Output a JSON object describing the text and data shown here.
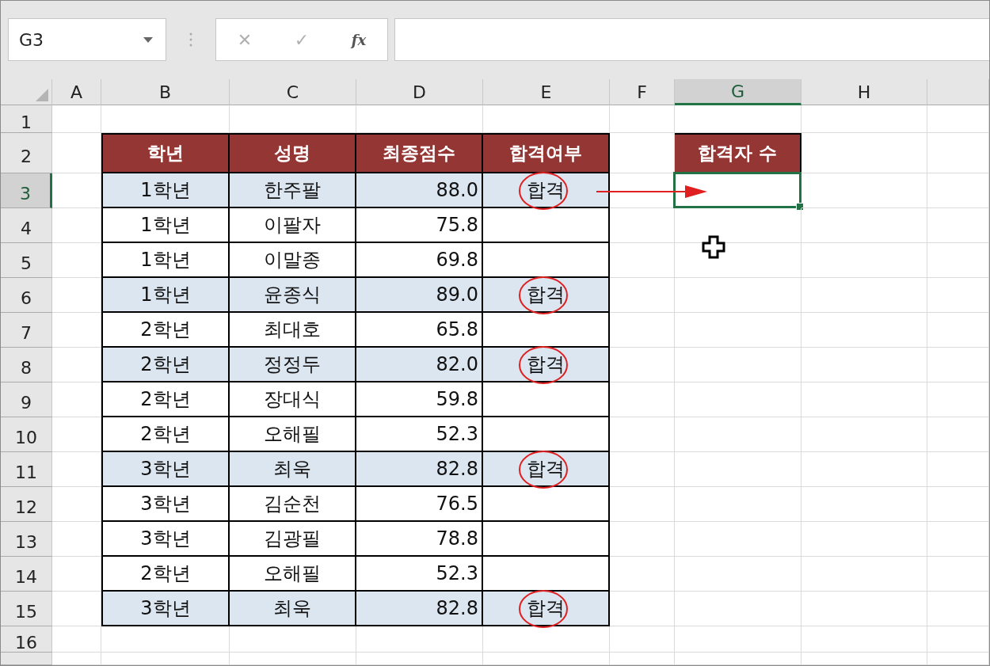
{
  "name_box": {
    "value": "G3"
  },
  "formula_bar": {
    "cancel": "✕",
    "enter": "✓",
    "function": "fx"
  },
  "columns": [
    {
      "label": "A",
      "selected": false
    },
    {
      "label": "B",
      "selected": false
    },
    {
      "label": "C",
      "selected": false
    },
    {
      "label": "D",
      "selected": false
    },
    {
      "label": "E",
      "selected": false
    },
    {
      "label": "F",
      "selected": false
    },
    {
      "label": "G",
      "selected": true
    },
    {
      "label": "H",
      "selected": false
    }
  ],
  "row_numbers": [
    {
      "label": "1",
      "selected": false
    },
    {
      "label": "2",
      "selected": false
    },
    {
      "label": "3",
      "selected": true
    },
    {
      "label": "4",
      "selected": false
    },
    {
      "label": "5",
      "selected": false
    },
    {
      "label": "6",
      "selected": false
    },
    {
      "label": "7",
      "selected": false
    },
    {
      "label": "8",
      "selected": false
    },
    {
      "label": "9",
      "selected": false
    },
    {
      "label": "10",
      "selected": false
    },
    {
      "label": "11",
      "selected": false
    },
    {
      "label": "12",
      "selected": false
    },
    {
      "label": "13",
      "selected": false
    },
    {
      "label": "14",
      "selected": false
    },
    {
      "label": "15",
      "selected": false
    },
    {
      "label": "16",
      "selected": false
    }
  ],
  "table": {
    "columns": [
      "학년",
      "성명",
      "최종점수",
      "합격여부"
    ],
    "rows": [
      {
        "grade": "1학년",
        "name": "한주팔",
        "score": "88.0",
        "result": "합격",
        "highlighted": true,
        "circled": true
      },
      {
        "grade": "1학년",
        "name": "이팔자",
        "score": "75.8",
        "result": "",
        "highlighted": false,
        "circled": false
      },
      {
        "grade": "1학년",
        "name": "이말종",
        "score": "69.8",
        "result": "",
        "highlighted": false,
        "circled": false
      },
      {
        "grade": "1학년",
        "name": "윤종식",
        "score": "89.0",
        "result": "합격",
        "highlighted": true,
        "circled": true
      },
      {
        "grade": "2학년",
        "name": "최대호",
        "score": "65.8",
        "result": "",
        "highlighted": false,
        "circled": false
      },
      {
        "grade": "2학년",
        "name": "정정두",
        "score": "82.0",
        "result": "합격",
        "highlighted": true,
        "circled": true
      },
      {
        "grade": "2학년",
        "name": "장대식",
        "score": "59.8",
        "result": "",
        "highlighted": false,
        "circled": false
      },
      {
        "grade": "2학년",
        "name": "오해필",
        "score": "52.3",
        "result": "",
        "highlighted": false,
        "circled": false
      },
      {
        "grade": "3학년",
        "name": "최욱",
        "score": "82.8",
        "result": "합격",
        "highlighted": true,
        "circled": true
      },
      {
        "grade": "3학년",
        "name": "김순천",
        "score": "76.5",
        "result": "",
        "highlighted": false,
        "circled": false
      },
      {
        "grade": "3학년",
        "name": "김광필",
        "score": "78.8",
        "result": "",
        "highlighted": false,
        "circled": false
      },
      {
        "grade": "2학년",
        "name": "오해필",
        "score": "52.3",
        "result": "",
        "highlighted": false,
        "circled": false
      },
      {
        "grade": "3학년",
        "name": "최욱",
        "score": "82.8",
        "result": "합격",
        "highlighted": true,
        "circled": true
      }
    ]
  },
  "summary": {
    "header": "합격자 수",
    "selected": true
  }
}
